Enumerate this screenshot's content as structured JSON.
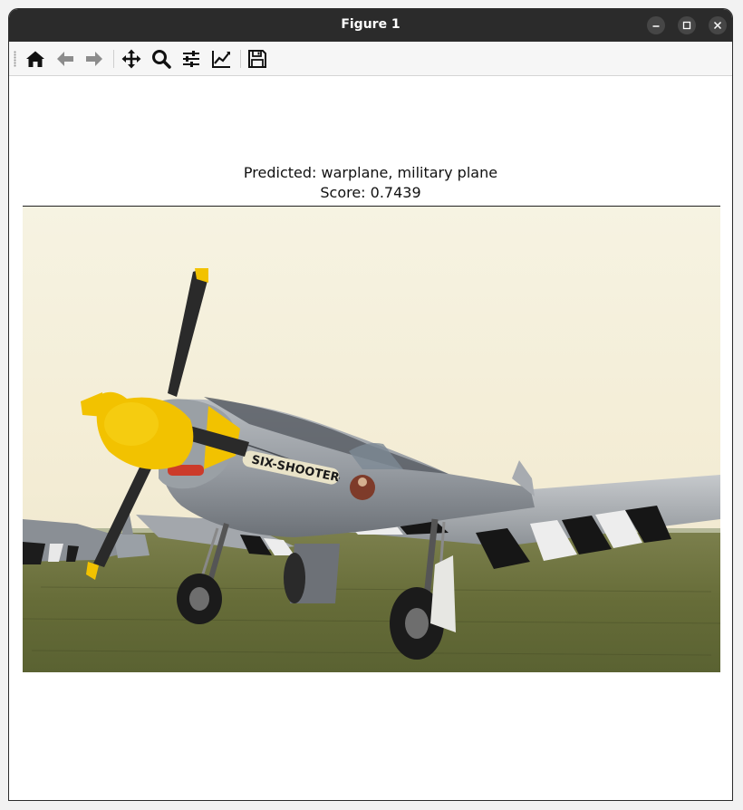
{
  "window": {
    "title": "Figure 1"
  },
  "toolbar": {
    "tools": [
      "home-icon",
      "back-arrow-icon",
      "forward-arrow-icon",
      "pan-move-icon",
      "zoom-magnifier-icon",
      "configure-subplots-icon",
      "edit-axes-lines-icon",
      "save-floppy-icon"
    ]
  },
  "figure": {
    "prediction_line": "Predicted: warplane, military plane",
    "score_line": "Score: 0.7439"
  },
  "colors": {
    "titlebar": "#2b2b2b",
    "sky": "#f4eed8",
    "grass": "#6a6f3a",
    "propeller_hub": "#f2c200"
  }
}
